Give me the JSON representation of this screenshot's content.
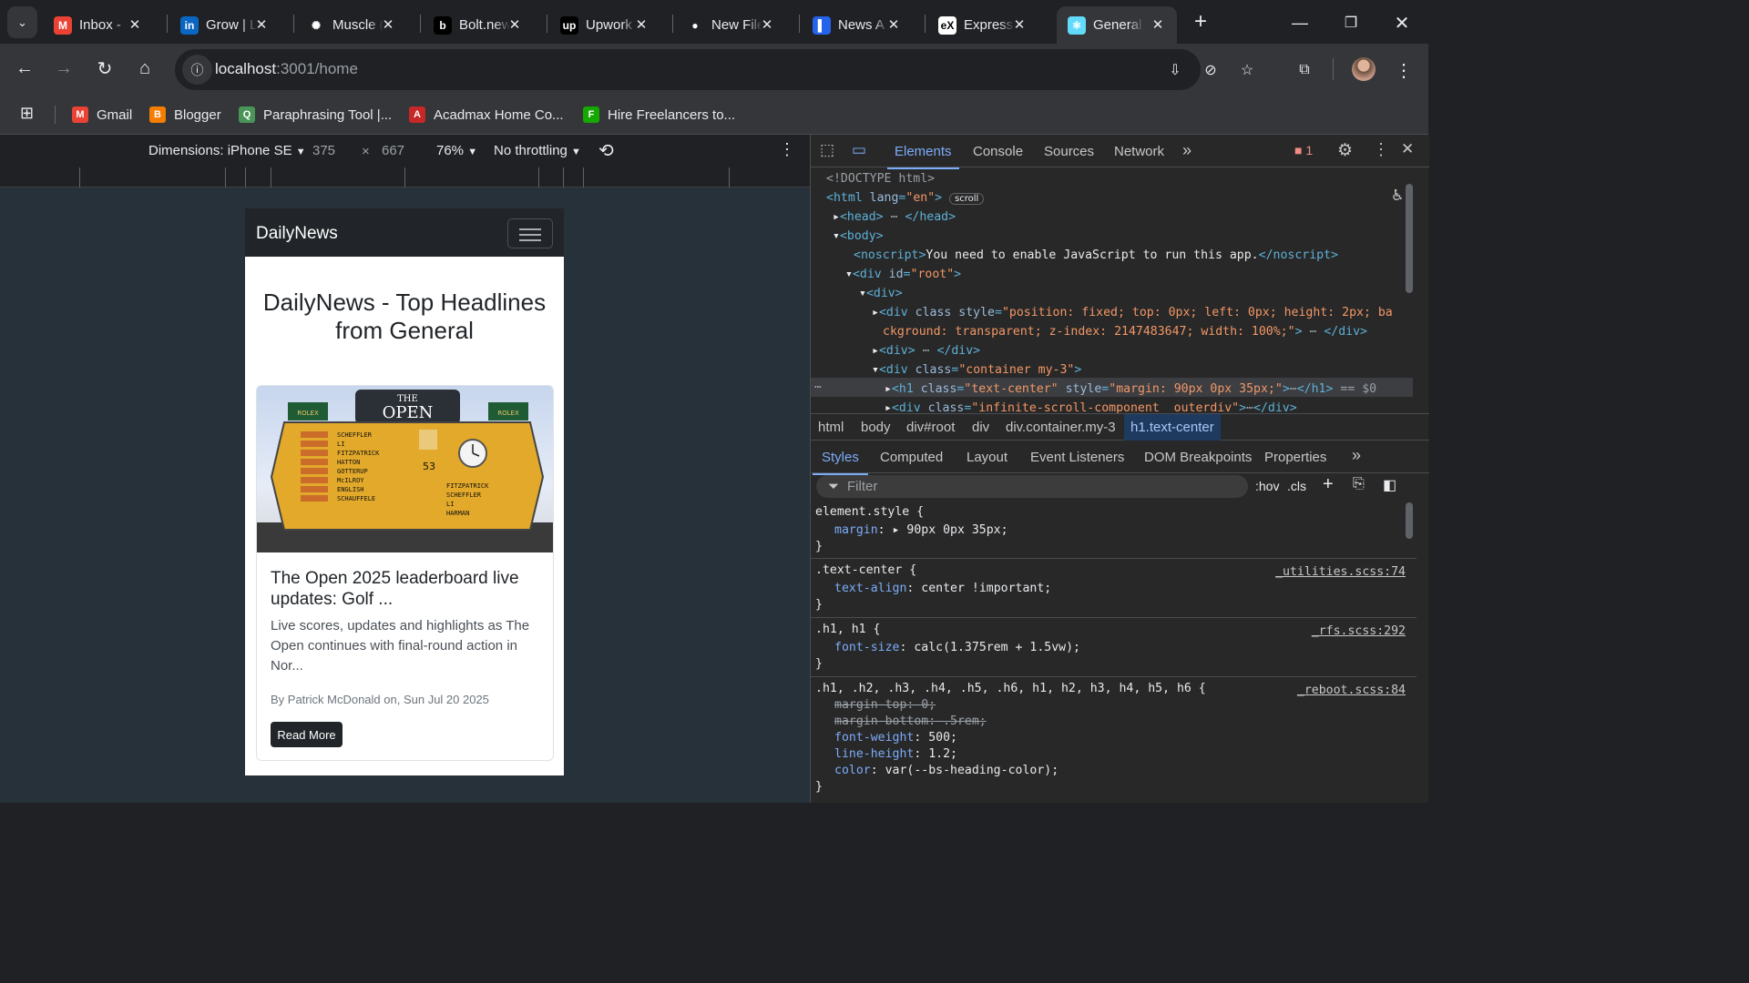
{
  "browser": {
    "tabs": [
      {
        "title": "Inbox - ",
        "icon": "gmail-icon",
        "color": "#ea4335",
        "glyph": "M"
      },
      {
        "title": "Grow | L",
        "icon": "linkedin-icon",
        "color": "#0a66c2",
        "glyph": "in"
      },
      {
        "title": "Muscle (",
        "icon": "openai-icon",
        "color": "#202124",
        "glyph": "✺"
      },
      {
        "title": "Bolt.new",
        "icon": "bolt-icon",
        "color": "#000000",
        "glyph": "b"
      },
      {
        "title": "Upwork",
        "icon": "upwork-icon",
        "color": "#000000",
        "glyph": "up"
      },
      {
        "title": "New File",
        "icon": "github-icon",
        "color": "#202124",
        "glyph": "●"
      },
      {
        "title": "News A",
        "icon": "news-app-icon",
        "color": "#2563eb",
        "glyph": "▌"
      },
      {
        "title": "Express",
        "icon": "express-icon",
        "color": "#ffffff",
        "glyph": "eX"
      },
      {
        "title": "General",
        "icon": "react-icon",
        "color": "#61dafb",
        "glyph": "⚛"
      }
    ],
    "new_tab": "+",
    "url_host": "localhost",
    "url_rest": ":3001/home",
    "bookmarks": [
      {
        "label": "Gmail",
        "icon": "gmail-icon",
        "color": "#ea4335",
        "glyph": "M"
      },
      {
        "label": "Blogger",
        "icon": "blogger-icon",
        "color": "#f57d00",
        "glyph": "B"
      },
      {
        "label": "Paraphrasing Tool |...",
        "icon": "quillbot-icon",
        "color": "#499557",
        "glyph": "Q"
      },
      {
        "label": "Acadmax Home Co...",
        "icon": "acadmax-icon",
        "color": "#c62828",
        "glyph": "A"
      },
      {
        "label": "Hire Freelancers to...",
        "icon": "freelancer-icon",
        "color": "#14a800",
        "glyph": "F"
      }
    ]
  },
  "device_toolbar": {
    "dimensions": "Dimensions: iPhone SE",
    "width": "375",
    "times": "×",
    "height": "667",
    "zoom": "76%",
    "throttling": "No throttling"
  },
  "page": {
    "brand": "DailyNews",
    "heading": "DailyNews - Top Headlines from General",
    "card": {
      "title": "The Open 2025 leaderboard live updates: Golf ...",
      "description": "Live scores, updates and highlights as The Open continues with final-round action in Nor...",
      "meta": "By Patrick McDonald on, Sun Jul 20 2025",
      "button": "Read More",
      "image_board": {
        "logo_top": "THE",
        "logo": "OPEN",
        "sponsor": "ROLEX",
        "players": [
          "SCHEFFLER",
          "LI",
          "FITZPATRICK",
          "HATTON",
          "GOTTERUP",
          "McILROY",
          "ENGLISH",
          "SCHAUFFELE"
        ],
        "right_players": [
          "FITZPATRICK",
          "SCHEFFLER",
          "LI",
          "HARMAN"
        ],
        "after_holes": "53"
      }
    }
  },
  "devtools": {
    "tabs": [
      "Elements",
      "Console",
      "Sources",
      "Network"
    ],
    "more": "»",
    "error_count": "1",
    "dom": {
      "doctype": "<!DOCTYPE html>",
      "html_lang": "en",
      "scroll_badge": "scroll",
      "head": "head",
      "body": "body",
      "noscript_text": "You need to enable JavaScript to run this app.",
      "root_id": "root",
      "fixed_style": "position: fixed; top: 0px; left: 0px; height: 2px; ba",
      "fixed_style2": "ckground: transparent; z-index: 2147483647; width: 100%;",
      "container_class": "container my-3",
      "h1_class": "text-center",
      "h1_style": "margin: 90px 0px 35px;",
      "selected_marker": "== $0",
      "infinite_class": "infinite-scroll-component__outerdiv"
    },
    "breadcrumbs": [
      "html",
      "body",
      "div#root",
      "div",
      "div.container.my-3",
      "h1.text-center"
    ],
    "style_tabs": [
      "Styles",
      "Computed",
      "Layout",
      "Event Listeners",
      "DOM Breakpoints",
      "Properties"
    ],
    "filter_placeholder": "Filter",
    "hov": ":hov",
    "cls": ".cls",
    "rules": {
      "element_style": "element.style {",
      "r1_prop": "margin",
      "r1_val": "90px 0px 35px;",
      "r2_sel": ".text-center {",
      "r2_src": "_utilities.scss:74",
      "r2_prop": "text-align",
      "r2_val": "center !important;",
      "r3_sel": ".h1, h1 {",
      "r3_src": "_rfs.scss:292",
      "r3_prop": "font-size",
      "r3_val": "calc(1.375rem + 1.5vw);",
      "r4_sel": ".h1, .h2, .h3, .h4, .h5, .h6, h1, h2, h3, h4, h5, h6 {",
      "r4_src": "_reboot.scss:84",
      "r4_p1": "margin-top",
      "r4_v1": "0;",
      "r4_p2": "margin-bottom",
      "r4_v2": ".5rem;",
      "r4_p3": "font-weight",
      "r4_v3": "500;",
      "r4_p4": "line-height",
      "r4_v4": "1.2;",
      "r4_p5": "color",
      "r4_v5": "var(--bs-heading-color);",
      "close": "}"
    }
  },
  "colors": {
    "accent": "#7cacf8",
    "navbar": "#212529",
    "page_bg": "#27313a"
  }
}
